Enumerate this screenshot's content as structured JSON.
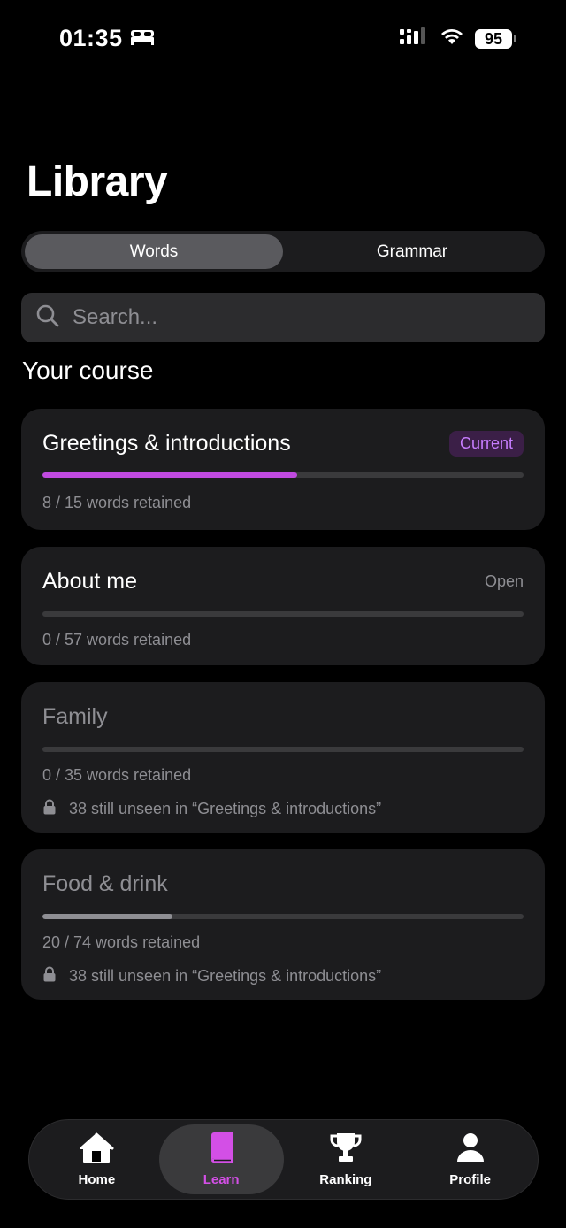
{
  "status": {
    "time": "01:35",
    "battery": "95"
  },
  "header": {
    "title": "Library"
  },
  "segments": [
    {
      "label": "Words",
      "active": true
    },
    {
      "label": "Grammar",
      "active": false
    }
  ],
  "search": {
    "placeholder": "Search..."
  },
  "section": {
    "title": "Your course"
  },
  "courses": [
    {
      "title": "Greetings & introductions",
      "tag": "Current",
      "progress": 0.53,
      "retained": "8 / 15 words retained",
      "lock_text": ""
    },
    {
      "title": "About me",
      "tag": "Open",
      "progress": 0,
      "retained": "0 / 57 words retained",
      "lock_text": ""
    },
    {
      "title": "Family",
      "tag": "",
      "progress": 0,
      "retained": "0 / 35 words retained",
      "lock_text": "38 still unseen in “Greetings & introductions”"
    },
    {
      "title": "Food & drink",
      "tag": "",
      "progress": 0.27,
      "retained": "20 / 74 words retained",
      "lock_text": "38 still unseen in “Greetings & introductions”"
    }
  ],
  "tabbar": {
    "items": [
      {
        "label": "Home",
        "icon": "home-icon"
      },
      {
        "label": "Learn",
        "icon": "book-icon",
        "active": true
      },
      {
        "label": "Ranking",
        "icon": "trophy-icon"
      },
      {
        "label": "Profile",
        "icon": "person-icon"
      }
    ]
  },
  "colors": {
    "accent": "#d34fe6",
    "progress_active": "#c04ae0",
    "progress_muted": "#8e8e93",
    "card_bg": "#1c1c1e"
  }
}
